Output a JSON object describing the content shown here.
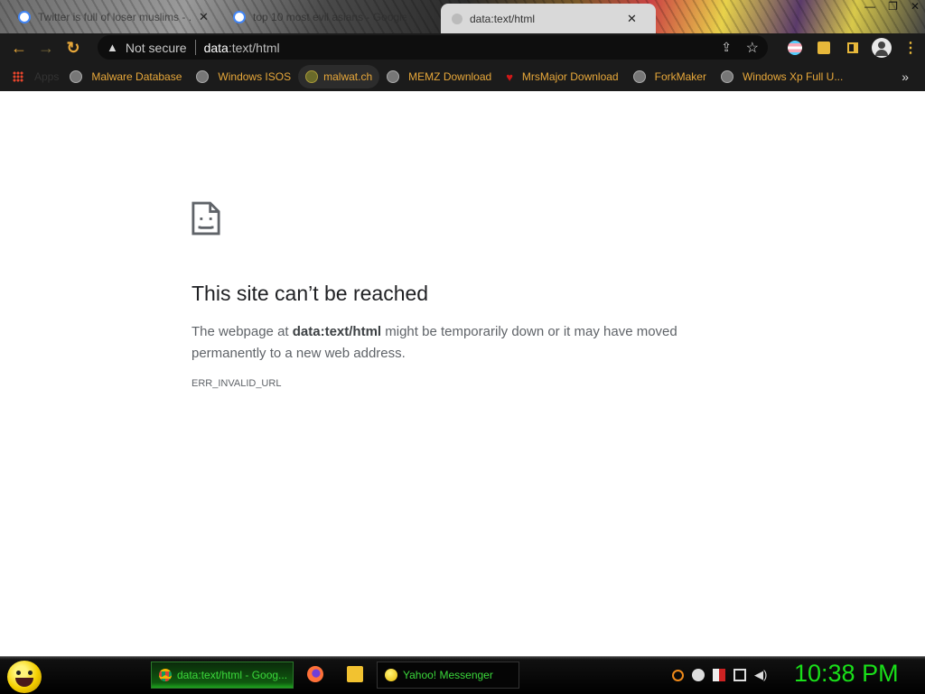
{
  "browser": {
    "tabs": [
      {
        "title": "Twitter is full of loser muslims - ...",
        "active": false
      },
      {
        "title": "top 10 most evil asians - Google ...",
        "active": false
      },
      {
        "title": "data:text/html",
        "active": true
      }
    ],
    "tab_close_glyph": "✕",
    "window_controls": {
      "minimize": "—",
      "restore": "❐",
      "close": "✕"
    },
    "toolbar": {
      "back_glyph": "←",
      "forward_glyph": "→",
      "reload_glyph": "↻",
      "security_icon": "warning-triangle-icon",
      "security_label": "Not secure",
      "url_scheme": "data",
      "url_rest": ":text/html",
      "share_glyph": "⇪",
      "star_glyph": "☆",
      "menu_glyph": "⋮"
    },
    "bookmarks": {
      "apps_label": "Apps",
      "items": [
        {
          "label": "Malware Database",
          "icon": "globe-icon"
        },
        {
          "label": "Windows ISOS",
          "icon": "globe-icon"
        },
        {
          "label": "malwat.ch",
          "icon": "malwatch-icon"
        },
        {
          "label": "MEMZ Download",
          "icon": "globe-icon"
        },
        {
          "label": "MrsMajor Download",
          "icon": "heart-icon"
        },
        {
          "label": "ForkMaker",
          "icon": "globe-icon"
        },
        {
          "label": "Windows Xp Full U...",
          "icon": "globe-icon"
        }
      ],
      "more_glyph": "»"
    }
  },
  "error_page": {
    "icon": "sad-page-icon",
    "title": "This site can’t be reached",
    "desc_before": "The webpage at ",
    "desc_url": "data:text/html",
    "desc_after": " might be temporarily down or it may have moved permanently to a new web address.",
    "code": "ERR_INVALID_URL"
  },
  "taskbar": {
    "tasks": [
      {
        "label": "data:text/html - Goog...",
        "icon": "chrome-icon",
        "active": true
      },
      {
        "label": "Yahoo! Messenger",
        "icon": "yahoo-smiley-icon",
        "active": false
      }
    ],
    "quick_launch": [
      "firefox-icon",
      "folder-icon"
    ],
    "tray_icons": [
      "search-icon",
      "minimize-circle-icon",
      "flag-icon",
      "network-icon",
      "volume-icon"
    ],
    "clock": "10:38 PM",
    "colors": {
      "clock": "#19e019",
      "task_text": "#3bd83b"
    }
  },
  "colors": {
    "bookmark_text": "#e8a83a",
    "toolbar_bg": "#1b1b1b",
    "error_title": "#202124",
    "error_text": "#5f6368"
  }
}
